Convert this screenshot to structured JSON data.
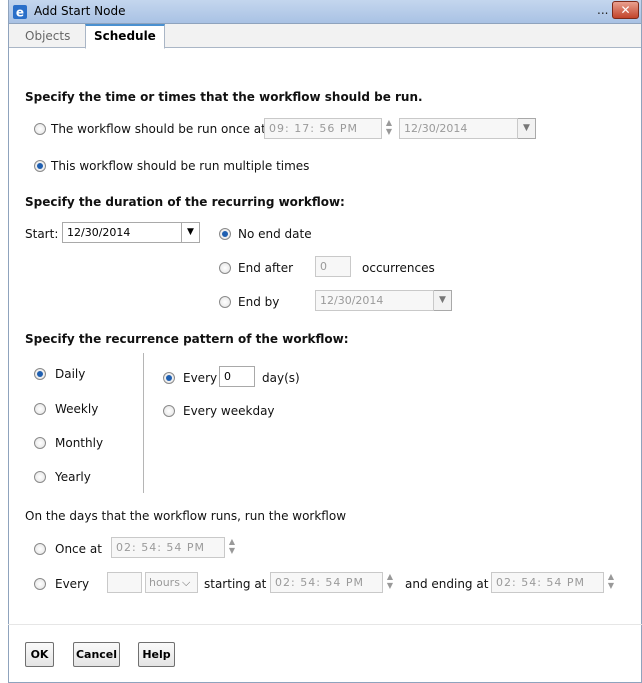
{
  "window": {
    "title": "Add Start Node",
    "title_dots": "...",
    "close_glyph": "✕"
  },
  "tabs": [
    {
      "label": "Objects",
      "active": false
    },
    {
      "label": "Schedule",
      "active": true
    }
  ],
  "section_time": {
    "heading": "Specify the time or times that the workflow should be run.",
    "once_label": "The workflow should be run once at",
    "once_selected": false,
    "once_time": "09: 17: 56  PM",
    "once_date": "12/30/2014",
    "multiple_label": "This workflow should be run multiple times",
    "multiple_selected": true
  },
  "section_duration": {
    "heading": "Specify the duration of the recurring workflow:",
    "start_label": "Start:",
    "start_date": "12/30/2014",
    "no_end_label": "No end date",
    "end_after_label": "End after",
    "end_after_value": "0",
    "occurrences_label": "occurrences",
    "end_by_label": "End by",
    "end_by_date": "12/30/2014",
    "selected": "No end date"
  },
  "section_pattern": {
    "heading": "Specify the recurrence pattern of the workflow:",
    "options": [
      "Daily",
      "Weekly",
      "Monthly",
      "Yearly"
    ],
    "selected": "Daily",
    "every_label": "Every",
    "every_value": "0",
    "days_unit": "day(s)",
    "weekday_label": "Every weekday"
  },
  "section_runs": {
    "heading": "On the days that the workflow runs, run the workflow",
    "once_at_label": "Once at",
    "once_at_time": "02: 54: 54  PM",
    "every_label": "Every",
    "every_value": "",
    "unit_value": "hours",
    "starting_at_label": "starting at",
    "starting_time": "02: 54: 54  PM",
    "ending_at_label": "and ending at",
    "ending_time": "02: 54: 54  PM"
  },
  "buttons": {
    "ok": "OK",
    "cancel": "Cancel",
    "help": "Help"
  },
  "colors": {
    "accent": "#1f5fb0",
    "tab_accent": "#4a90d0",
    "close": "#c2432a"
  }
}
